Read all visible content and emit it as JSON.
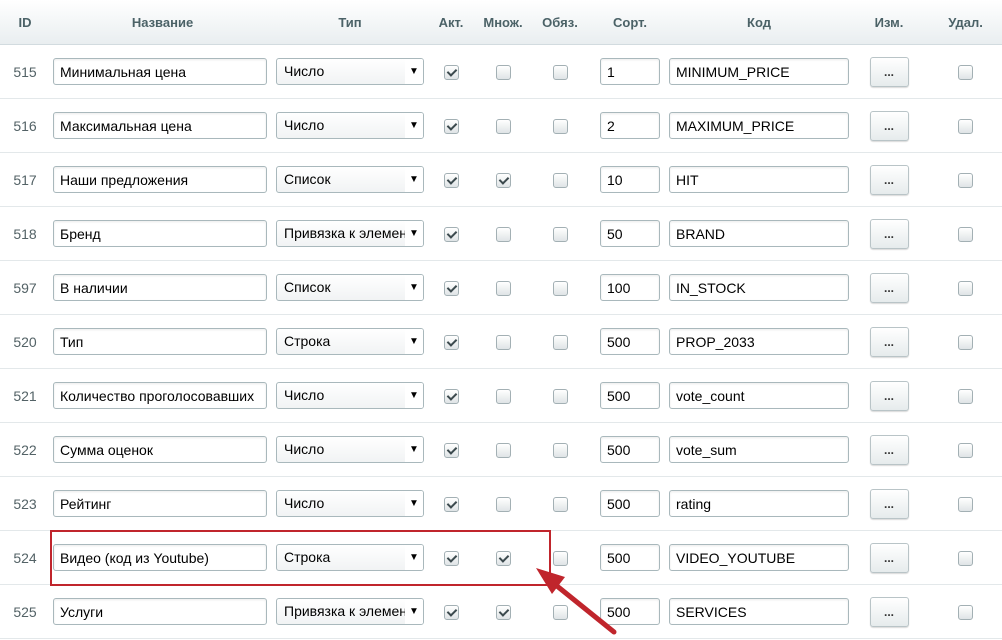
{
  "headers": {
    "id": "ID",
    "name": "Название",
    "type": "Тип",
    "active": "Акт.",
    "multiple": "Множ.",
    "required": "Обяз.",
    "sort": "Сорт.",
    "code": "Код",
    "edit": "Изм.",
    "delete": "Удал."
  },
  "rows": [
    {
      "id": "515",
      "name": "Минимальная цена",
      "type": "Число",
      "active": true,
      "multiple": false,
      "required": false,
      "sort": "1",
      "code": "MINIMUM_PRICE",
      "edit": "...",
      "delete": false
    },
    {
      "id": "516",
      "name": "Максимальная цена",
      "type": "Число",
      "active": true,
      "multiple": false,
      "required": false,
      "sort": "2",
      "code": "MAXIMUM_PRICE",
      "edit": "...",
      "delete": false
    },
    {
      "id": "517",
      "name": "Наши предложения",
      "type": "Список",
      "active": true,
      "multiple": true,
      "required": false,
      "sort": "10",
      "code": "HIT",
      "edit": "...",
      "delete": false
    },
    {
      "id": "518",
      "name": "Бренд",
      "type": "Привязка к элемент",
      "active": true,
      "multiple": false,
      "required": false,
      "sort": "50",
      "code": "BRAND",
      "edit": "...",
      "delete": false
    },
    {
      "id": "597",
      "name": "В наличии",
      "type": "Список",
      "active": true,
      "multiple": false,
      "required": false,
      "sort": "100",
      "code": "IN_STOCK",
      "edit": "...",
      "delete": false
    },
    {
      "id": "520",
      "name": "Тип",
      "type": "Строка",
      "active": true,
      "multiple": false,
      "required": false,
      "sort": "500",
      "code": "PROP_2033",
      "edit": "...",
      "delete": false
    },
    {
      "id": "521",
      "name": "Количество проголосовавших",
      "type": "Число",
      "active": true,
      "multiple": false,
      "required": false,
      "sort": "500",
      "code": "vote_count",
      "edit": "...",
      "delete": false
    },
    {
      "id": "522",
      "name": "Сумма оценок",
      "type": "Число",
      "active": true,
      "multiple": false,
      "required": false,
      "sort": "500",
      "code": "vote_sum",
      "edit": "...",
      "delete": false
    },
    {
      "id": "523",
      "name": "Рейтинг",
      "type": "Число",
      "active": true,
      "multiple": false,
      "required": false,
      "sort": "500",
      "code": "rating",
      "edit": "...",
      "delete": false
    },
    {
      "id": "524",
      "name": "Видео (код из Youtube)",
      "type": "Строка",
      "active": true,
      "multiple": true,
      "required": false,
      "sort": "500",
      "code": "VIDEO_YOUTUBE",
      "edit": "...",
      "delete": false
    },
    {
      "id": "525",
      "name": "Услуги",
      "type": "Привязка к элемент",
      "active": true,
      "multiple": true,
      "required": false,
      "sort": "500",
      "code": "SERVICES",
      "edit": "...",
      "delete": false
    }
  ],
  "annotation": {
    "color": "#c0252c"
  },
  "icons": {
    "select_arrow": "chevron-down-icon",
    "checkmark": "check-icon"
  }
}
